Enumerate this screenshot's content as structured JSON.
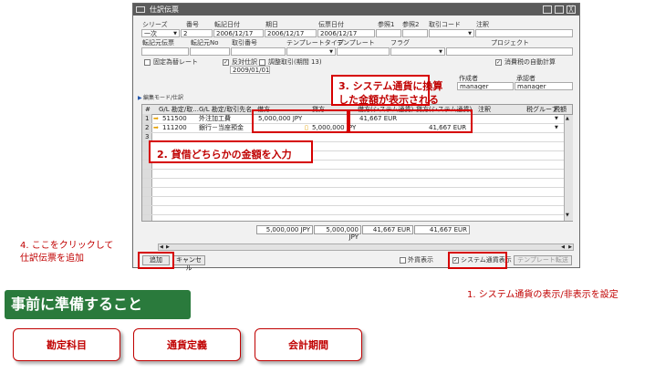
{
  "window": {
    "title": "仕訳伝票",
    "header_labels": [
      "シリーズ",
      "番号",
      "転記日付",
      "期日",
      "伝票日付",
      "参照1",
      "参照2",
      "取引コード",
      "注釈"
    ],
    "series_value": "一次",
    "number_value": "2",
    "posting_date": "2006/12/17",
    "due_date": "2006/12/17",
    "doc_date": "2006/12/17",
    "labels_row2": [
      "転記元伝票",
      "転記元No",
      "取引番号",
      "テンプレートタイプ",
      "テンプレート",
      "フラグ",
      "プロジェクト"
    ],
    "fixed_rate_label": "固定為替レート",
    "reversal_label": "反対仕訳",
    "reversal_date": "2009/01/01",
    "adjust_label": "調整取引(期間 13)",
    "auto_tax_label": "消費税の自動計算",
    "creator_label": "作成者",
    "approver_label": "承認者",
    "creator_value": "manager",
    "approver_value": "manager",
    "edit_mode_label": "編集モード/仕訳",
    "columns": [
      "#",
      "G/L 勘定/取...",
      "G/L 勘定/取引先名",
      "借方",
      "貸方",
      "借方(システム通貨)",
      "貸方(システム通貨)",
      "注釈",
      "税グループ",
      "税額"
    ],
    "rows": [
      {
        "num": "1",
        "account": "511500",
        "name": "外注加工費",
        "debit": "5,000,000 JPY",
        "credit": "",
        "sys_debit": "41,667 EUR",
        "sys_credit": ""
      },
      {
        "num": "2",
        "account": "111200",
        "name": "銀行－当座預金",
        "debit": "",
        "credit": "5,000,000 JPY",
        "sys_debit": "",
        "sys_credit": "41,667 EUR"
      },
      {
        "num": "3",
        "account": "",
        "name": "",
        "debit": "",
        "credit": "",
        "sys_debit": "",
        "sys_credit": ""
      }
    ],
    "totals": {
      "debit": "5,000,000 JPY",
      "credit": "5,000,000 JPY",
      "sys_debit": "41,667 EUR",
      "sys_credit": "41,667 EUR"
    },
    "add_button": "追加",
    "cancel_button": "キャンセル",
    "foreign_label": "外貨表示",
    "system_label": "システム通貨表示",
    "template_button": "テンプレート転送"
  },
  "annotations": {
    "step1": "1. システム通貨の表示/非表示を設定",
    "step2": "2. 貸借どちらかの金額を入力",
    "step3_line1": "3. システム通貨に換算",
    "step3_line2": "した金額が表示される",
    "step4_line1": "4. ここをクリックして",
    "step4_line2": "仕訳伝票を追加"
  },
  "prep_title": "事前に準備すること",
  "tabs": [
    "勘定科目",
    "通貨定義",
    "会計期間"
  ],
  "colors": {
    "red": "#c00000",
    "green": "#2a7a3c"
  }
}
